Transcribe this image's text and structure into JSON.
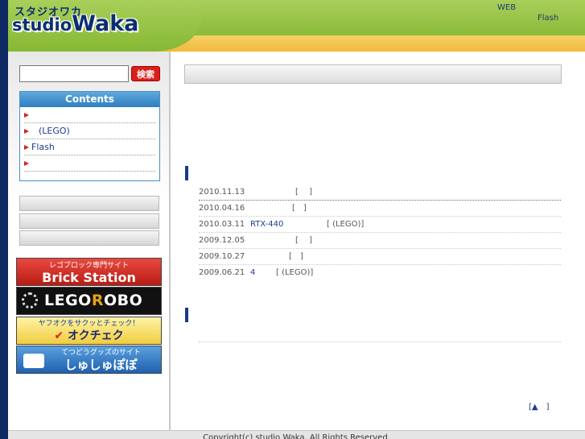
{
  "header": {
    "logo_kana": "スタジオワカ",
    "logo_studio": "studio",
    "logo_waka": "Waka",
    "nav_web": "WEB",
    "nav_flash": "Flash"
  },
  "sidebar": {
    "search_button": "検索",
    "contents_title": "Contents",
    "contents_items": [
      "",
      "(LEGO)",
      "Flash",
      ""
    ],
    "banners": {
      "brick_sub": "レゴブロック専門サイト",
      "brick_main": "Brick Station",
      "lego_pre": "LEGO",
      "lego_o": "R",
      "lego_post": "OBO",
      "okuchek_sub": "ヤフオクをサクッとチェック！",
      "okuchek_main": "オクチェク",
      "shushu_sub": "てつどうグッズのサイト",
      "shushu_main": "しゅしゅぽぽ"
    }
  },
  "news": [
    {
      "date": "2010.11.13",
      "link": "",
      "tag": "[　 ]"
    },
    {
      "date": "2010.04.16",
      "link": "",
      "tag": "[　]"
    },
    {
      "date": "2010.03.11",
      "link": "RTX-440",
      "tag": "[ (LEGO)]"
    },
    {
      "date": "2009.12.05",
      "link": "",
      "tag": "[　 ]"
    },
    {
      "date": "2009.10.27",
      "link": "",
      "tag": "[　]"
    },
    {
      "date": "2009.06.21",
      "link": "4",
      "tag": "[ (LEGO)]"
    }
  ],
  "page_top": "[▲　]",
  "footer": "Copyright(c) studio Waka. All Rights Reserved.",
  "colors": {
    "header_green": "#8fbd3a",
    "header_band": "#f2c24a",
    "navy": "#0f2a63",
    "accent_red": "#d9201a"
  }
}
